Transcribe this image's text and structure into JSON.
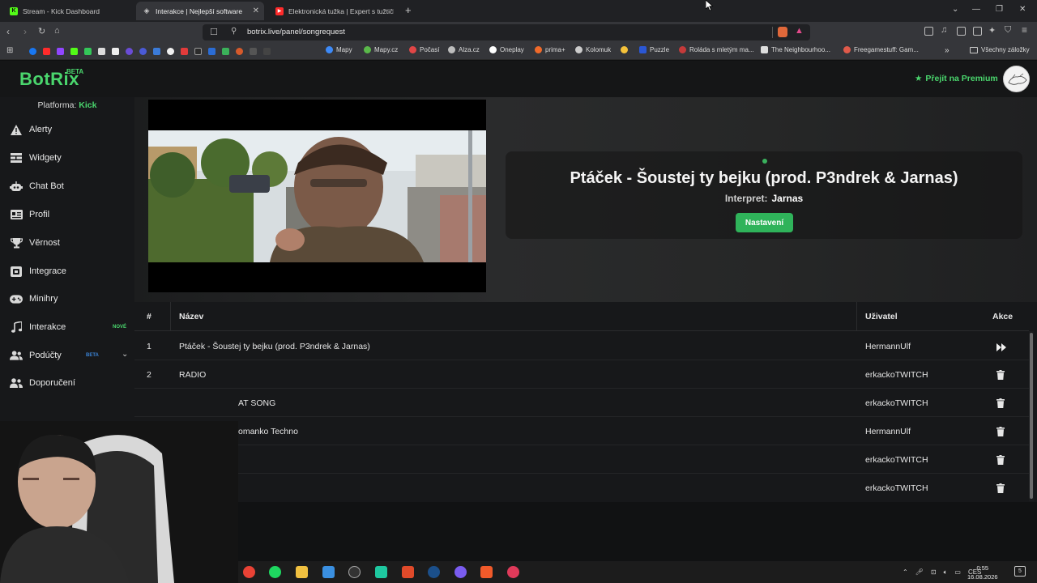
{
  "browser": {
    "tabs": [
      {
        "title": "Stream - Kick Dashboard",
        "fav": "K",
        "color": "#53fc18"
      },
      {
        "title": "Interakce | Nejlepší software",
        "fav": "◈",
        "color": "#cfcfcf"
      },
      {
        "title": "Elektronická tužka | Expert s tužtičkou",
        "fav": "▶",
        "color": "#ff2b2b"
      }
    ],
    "new_tab": "+",
    "url": "botrix.live/panel/songrequest",
    "bookmarks": [
      {
        "label": "Mapy",
        "color": "#3d8af7"
      },
      {
        "label": "Mapy.cz",
        "color": "#5ab94a"
      },
      {
        "label": "Počasí",
        "color": "#e14646"
      },
      {
        "label": "Alza.cz",
        "color": "#bdbdbd"
      },
      {
        "label": "Oneplay",
        "color": "#ffffff"
      },
      {
        "label": "prima+",
        "color": "#f06a2a"
      },
      {
        "label": "Kolomuk",
        "color": "#cccccc"
      },
      {
        "label": "Puzzle",
        "color": "#2b57d4"
      },
      {
        "label": "Roláda s mletým ma...",
        "color": "#c53a3a"
      },
      {
        "label": "The Neighbourhoo...",
        "color": "#dddddd"
      },
      {
        "label": "Freegamestuff: Gam...",
        "color": "#e05a4a"
      }
    ],
    "all_bookmarks": "Všechny záložky"
  },
  "app": {
    "logo": "BotRix",
    "logo_badge": "BETA",
    "premium_label": "Přejít na Premium",
    "platform_label": "Platforma:",
    "platform_value": "Kick",
    "sidebar": [
      {
        "label": "Alerty",
        "icon": "warning-icon"
      },
      {
        "label": "Widgety",
        "icon": "widgets-icon"
      },
      {
        "label": "Chat Bot",
        "icon": "robot-icon"
      },
      {
        "label": "Profil",
        "icon": "profile-card-icon"
      },
      {
        "label": "Věrnost",
        "icon": "trophy-icon"
      },
      {
        "label": "Integrace",
        "icon": "integration-icon"
      },
      {
        "label": "Minihry",
        "icon": "gamepad-icon"
      },
      {
        "label": "Interakce",
        "icon": "music-note-icon",
        "badge": "NOVÉ"
      },
      {
        "label": "Podúčty",
        "icon": "users-icon",
        "badge": "BETA"
      },
      {
        "label": "Doporučení",
        "icon": "referral-icon"
      }
    ],
    "now_playing": {
      "title": "Ptáček - Šoustej ty bejku (prod. P3ndrek & Jarnas)",
      "artist_label": "Interpret:",
      "artist": "Jarnas",
      "settings_label": "Nastavení"
    },
    "queue": {
      "headers": {
        "num": "#",
        "name": "Název",
        "user": "Uživatel",
        "actions": "Akce"
      },
      "rows": [
        {
          "num": "1",
          "name": "Ptáček - Šoustej ty bejku (prod. P3ndrek & Jarnas)",
          "user": "HermannUlf",
          "action": "skip"
        },
        {
          "num": "2",
          "name": "RADIO",
          "user": "erkackoTWITCH",
          "action": "delete"
        },
        {
          "num": "",
          "name": "AT SONG",
          "user": "erkackoTWITCH",
          "action": "delete"
        },
        {
          "num": "",
          "name": "omanko Techno",
          "user": "HermannUlf",
          "action": "delete"
        },
        {
          "num": "",
          "name": "",
          "user": "erkackoTWITCH",
          "action": "delete"
        },
        {
          "num": "",
          "name": "",
          "user": "erkackoTWITCH",
          "action": "delete"
        }
      ]
    }
  },
  "taskbar": {
    "lang": "CES",
    "time": "0:55",
    "date": "16.08.2026",
    "notif_count": "5"
  }
}
